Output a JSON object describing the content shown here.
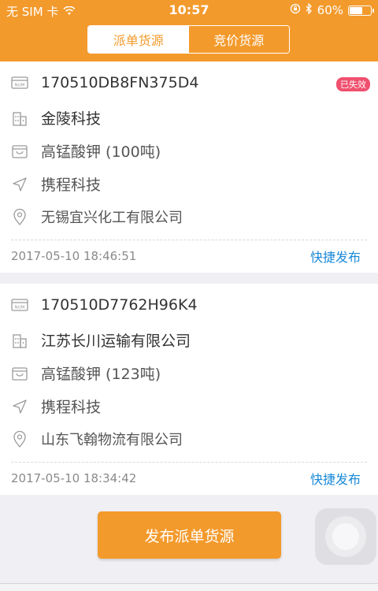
{
  "status_bar": {
    "carrier": "无 SIM 卡",
    "time": "10:57",
    "battery_percent": "60%",
    "battery_level": 0.6
  },
  "tabs": [
    {
      "label": "派单货源",
      "active": true
    },
    {
      "label": "竞价货源",
      "active": false
    }
  ],
  "orders": [
    {
      "order_no": "170510DB8FN375D4",
      "expired_badge": "已失效",
      "company": "金陵科技",
      "cargo": "高锰酸钾 (100吨)",
      "carrier": "携程科技",
      "location": "无锡宜兴化工有限公司",
      "timestamp": "2017-05-10 18:46:51",
      "action": "快捷发布"
    },
    {
      "order_no": "170510D7762H96K4",
      "company": "江苏长川运输有限公司",
      "cargo": "高锰酸钾 (123吨)",
      "carrier": "携程科技",
      "location": "山东飞翰物流有限公司",
      "timestamp": "2017-05-10 18:34:42",
      "action": "快捷发布"
    }
  ],
  "publish_button": "发布派单货源",
  "colors": {
    "accent": "#f39a2c",
    "link": "#1a8ad8",
    "badge": "#f0506e"
  },
  "icons": [
    "num-icon",
    "building-icon",
    "box-icon",
    "navigation-arrow-icon",
    "location-pin-icon",
    "wifi-icon",
    "lock-rotation-icon",
    "bluetooth-icon",
    "battery-icon"
  ]
}
